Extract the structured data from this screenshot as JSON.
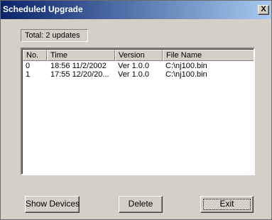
{
  "window": {
    "title": "Scheduled Upgrade",
    "close_glyph": "X"
  },
  "summary": {
    "total_text": "Total: 2 updates"
  },
  "table": {
    "columns": [
      "No.",
      "Time",
      "Version",
      "File Name"
    ],
    "rows": [
      [
        "0",
        "18:56 11/2/2002",
        "Ver 1.0.0",
        "C:\\nj100.bin"
      ],
      [
        "1",
        "17:55 12/20/20...",
        "Ver 1.0.0",
        "C:\\nj100.bin"
      ]
    ]
  },
  "buttons": {
    "show_devices": "Show Devices",
    "delete": "Delete",
    "exit": "Exit"
  }
}
